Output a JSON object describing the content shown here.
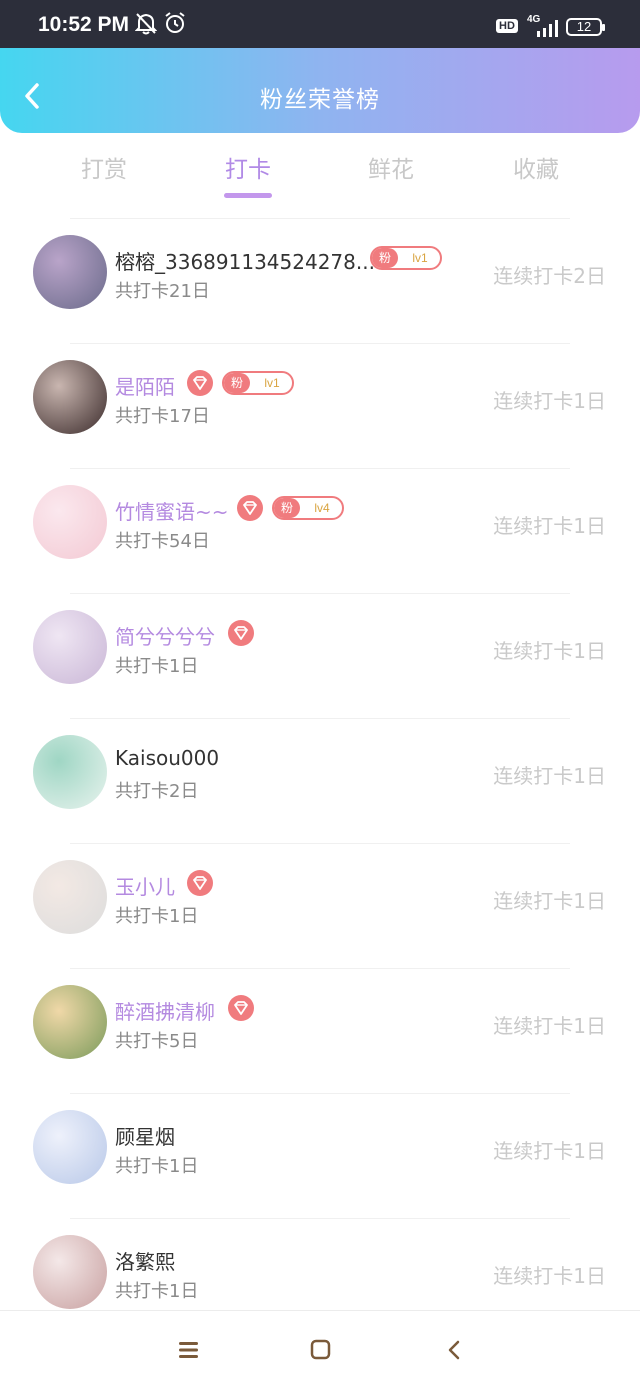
{
  "status_bar": {
    "time": "10:52 PM",
    "icons": [
      "bell-off-icon",
      "alarm-icon",
      "hd-icon",
      "signal-4g-icon",
      "battery-icon"
    ],
    "hd_label": "HD",
    "network_label": "4G",
    "battery_level": "12"
  },
  "header": {
    "title": "粉丝荣誉榜",
    "back_icon": "chevron-left-icon",
    "gradient_colors": [
      "#45d6f0",
      "#b79bee"
    ]
  },
  "tabs": [
    {
      "label": "打赏",
      "active": false
    },
    {
      "label": "打卡",
      "active": true
    },
    {
      "label": "鲜花",
      "active": false
    },
    {
      "label": "收藏",
      "active": false
    }
  ],
  "colors": {
    "active_tab": "#b18ae6",
    "vip_name": "#b48ae0",
    "badge": "#f07b7e",
    "muted": "#c9c9c9"
  },
  "rows": [
    {
      "name": "榕榕_336891134524278...",
      "vip": false,
      "fan_badge": true,
      "fan_label": "粉",
      "level": "lv1",
      "total": "共打卡21日",
      "streak": "连续打卡2日"
    },
    {
      "name": "是陌陌",
      "vip": true,
      "fan_badge": true,
      "fan_label": "粉",
      "level": "lv1",
      "total": "共打卡17日",
      "streak": "连续打卡1日"
    },
    {
      "name": "竹情蜜语~~",
      "vip": true,
      "fan_badge": true,
      "fan_label": "粉",
      "level": "lv4",
      "total": "共打卡54日",
      "streak": "连续打卡1日"
    },
    {
      "name": "简兮兮兮兮",
      "vip": true,
      "fan_badge": false,
      "total": "共打卡1日",
      "streak": "连续打卡1日"
    },
    {
      "name": "Kaisou000",
      "vip": false,
      "fan_badge": false,
      "total": "共打卡2日",
      "streak": "连续打卡1日"
    },
    {
      "name": "玉小儿",
      "vip": true,
      "fan_badge": false,
      "total": "共打卡1日",
      "streak": "连续打卡1日"
    },
    {
      "name": "醉酒拂清柳",
      "vip": true,
      "fan_badge": false,
      "total": "共打卡5日",
      "streak": "连续打卡1日"
    },
    {
      "name": "顾星烟",
      "vip": false,
      "fan_badge": false,
      "total": "共打卡1日",
      "streak": "连续打卡1日"
    },
    {
      "name": "洛繁熙",
      "vip": false,
      "fan_badge": false,
      "total": "共打卡1日",
      "streak": "连续打卡1日"
    }
  ],
  "nav_bar": {
    "icons": [
      "menu-icon",
      "home-icon",
      "back-icon"
    ]
  }
}
